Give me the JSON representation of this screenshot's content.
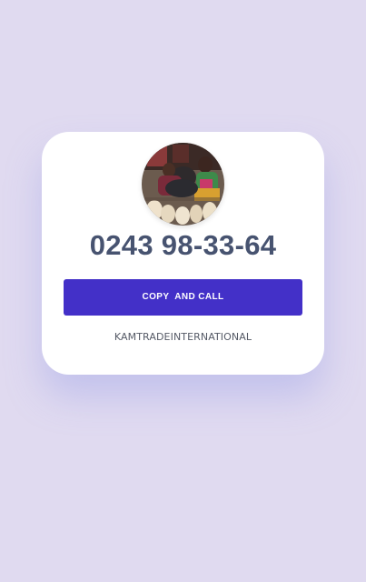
{
  "contact": {
    "phone": "0243 98-33-64",
    "cta_label": "COPY  AND CALL",
    "company": "KAMTRADEINTERNATIONAL",
    "avatar_icon": "market-vendor-photo"
  },
  "colors": {
    "background": "#e0daf0",
    "card": "#ffffff",
    "phone_text": "#475370",
    "button": "#4330c8",
    "button_text": "#ffffff"
  }
}
